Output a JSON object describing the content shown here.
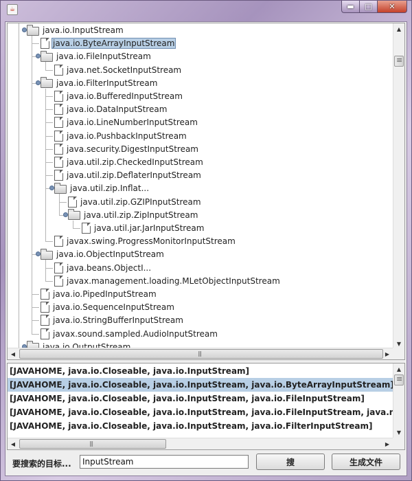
{
  "window": {
    "icon": "java-cup-icon",
    "controls": {
      "minimize": "▬",
      "maximize": "□",
      "close": "✕"
    }
  },
  "tree": {
    "nodes": [
      {
        "label": "java.io.InputStream",
        "type": "folder",
        "level": 0,
        "toggle": true
      },
      {
        "label": "java.io.ByteArrayInputStream",
        "type": "file",
        "level": 1,
        "selected": true
      },
      {
        "label": "java.io.FileInputStream",
        "type": "folder",
        "level": 1,
        "toggle": true
      },
      {
        "label": "java.net.SocketInputStream",
        "type": "file",
        "level": 2
      },
      {
        "label": "java.io.FilterInputStream",
        "type": "folder",
        "level": 1,
        "toggle": true
      },
      {
        "label": "java.io.BufferedInputStream",
        "type": "file",
        "level": 2
      },
      {
        "label": "java.io.DataInputStream",
        "type": "file",
        "level": 2
      },
      {
        "label": "java.io.LineNumberInputStream",
        "type": "file",
        "level": 2
      },
      {
        "label": "java.io.PushbackInputStream",
        "type": "file",
        "level": 2
      },
      {
        "label": "java.security.DigestInputStream",
        "type": "file",
        "level": 2
      },
      {
        "label": "java.util.zip.CheckedInputStream",
        "type": "file",
        "level": 2
      },
      {
        "label": "java.util.zip.DeflaterInputStream",
        "type": "file",
        "level": 2
      },
      {
        "label": "java.util.zip.Inflat...",
        "type": "folder",
        "level": 2,
        "toggle": true
      },
      {
        "label": "java.util.zip.GZIPInputStream",
        "type": "file",
        "level": 3
      },
      {
        "label": "java.util.zip.ZipInputStream",
        "type": "folder",
        "level": 3,
        "toggle": true
      },
      {
        "label": "java.util.jar.JarInputStream",
        "type": "file",
        "level": 4
      },
      {
        "label": "javax.swing.ProgressMonitorInputStream",
        "type": "file",
        "level": 2
      },
      {
        "label": "java.io.ObjectInputStream",
        "type": "folder",
        "level": 1,
        "toggle": true
      },
      {
        "label": "java.beans.ObjectI...",
        "type": "file",
        "level": 2
      },
      {
        "label": "javax.management.loading.MLetObjectInputStream",
        "type": "file",
        "level": 2
      },
      {
        "label": "java.io.PipedInputStream",
        "type": "file",
        "level": 1
      },
      {
        "label": "java.io.SequenceInputStream",
        "type": "file",
        "level": 1
      },
      {
        "label": "java.io.StringBufferInputStream",
        "type": "file",
        "level": 1
      },
      {
        "label": "javax.sound.sampled.AudioInputStream",
        "type": "file",
        "level": 1
      },
      {
        "label": "java.io.OutputStream",
        "type": "folder",
        "level": 0,
        "toggle": true
      }
    ]
  },
  "list": {
    "items": [
      "[JAVAHOME, java.io.Closeable, java.io.InputStream]",
      "[JAVAHOME, java.io.Closeable, java.io.InputStream, java.io.ByteArrayInputStream]",
      "[JAVAHOME, java.io.Closeable, java.io.InputStream, java.io.FileInputStream]",
      "[JAVAHOME, java.io.Closeable, java.io.InputStream, java.io.FileInputStream, java.net.SocketInputStream]",
      "[JAVAHOME, java.io.Closeable, java.io.InputStream, java.io.FilterInputStream]"
    ],
    "selected_index": 1
  },
  "search": {
    "label": "要搜索的目标...",
    "value": "InputStream",
    "search_button": "搜",
    "generate_button": "生成文件"
  }
}
